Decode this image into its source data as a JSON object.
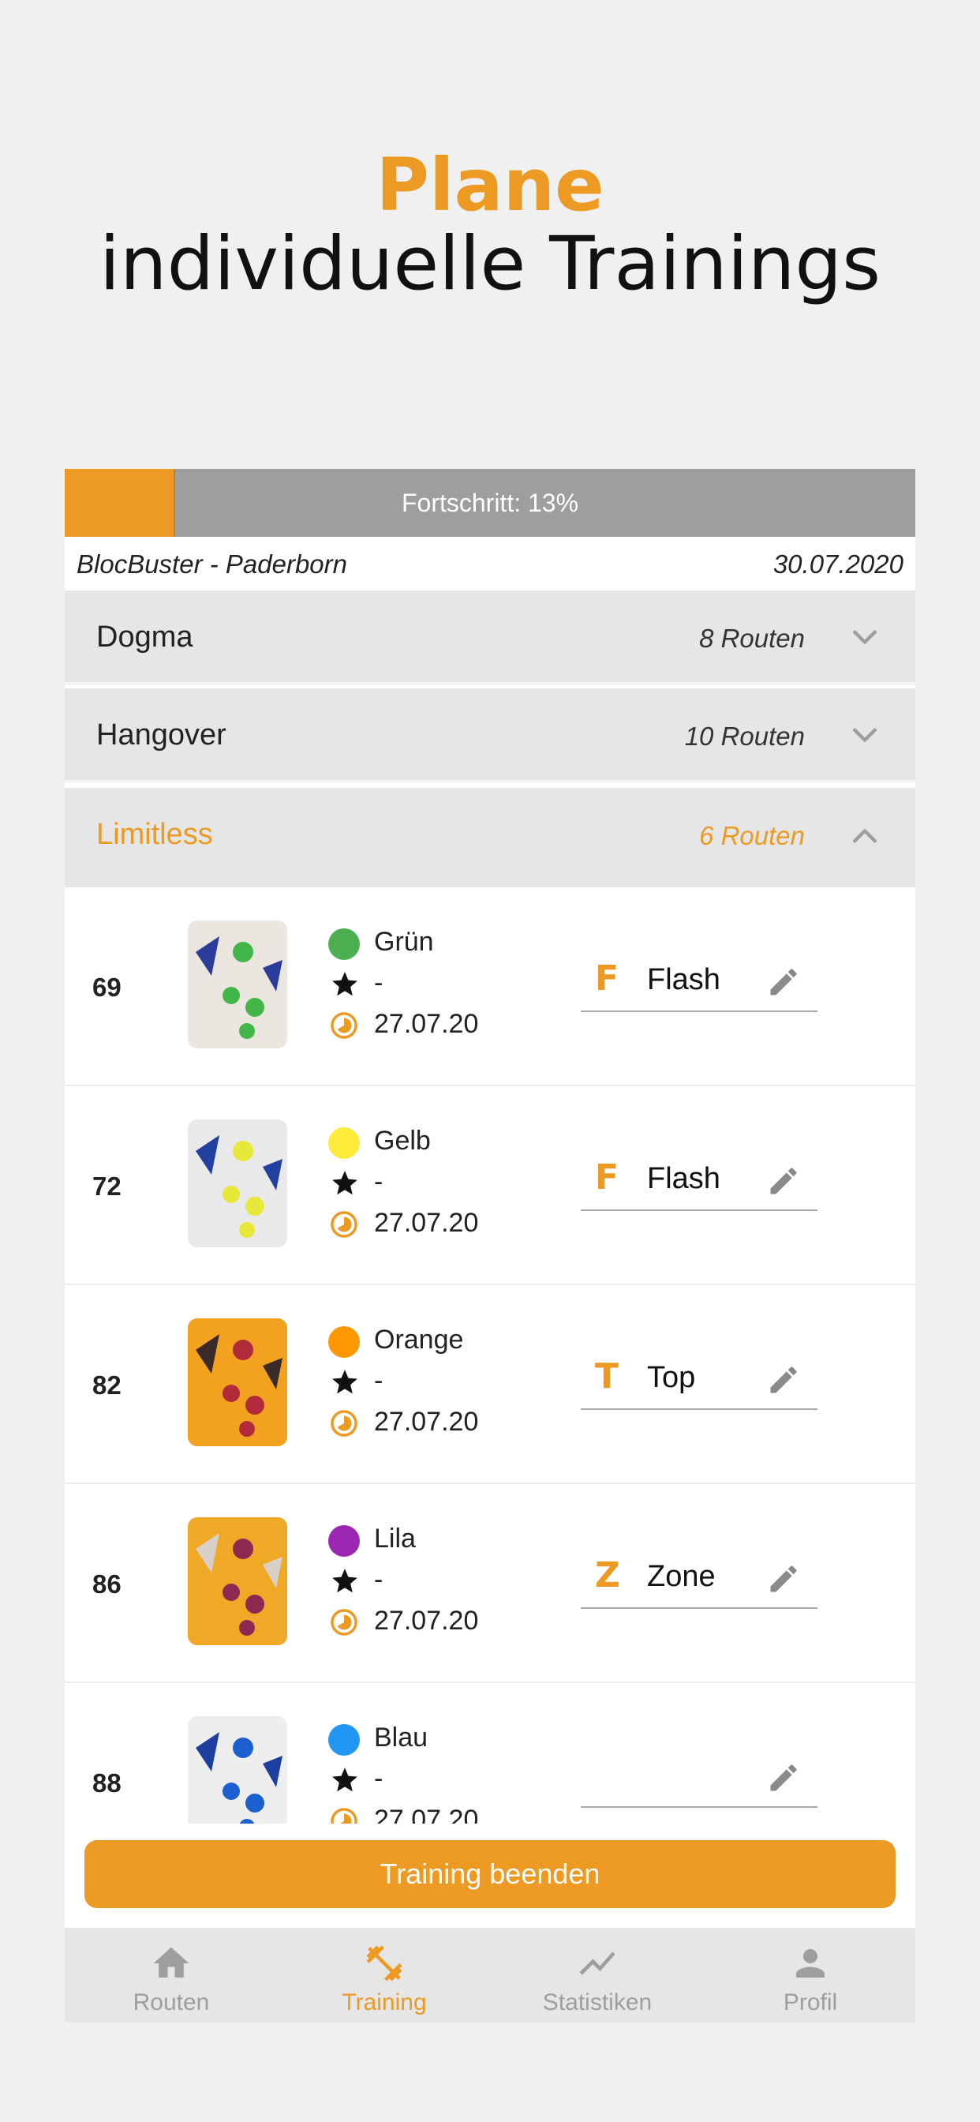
{
  "headline": {
    "line1": "Plane",
    "line2": "individuelle Trainings"
  },
  "progress": {
    "label": "Fortschritt: 13%",
    "value": 0.13
  },
  "session": {
    "location": "BlocBuster - Paderborn",
    "date": "30.07.2020"
  },
  "groups": [
    {
      "name": "Dogma",
      "count": "8 Routen",
      "expanded": false
    },
    {
      "name": "Hangover",
      "count": "10 Routen",
      "expanded": false
    },
    {
      "name": "Limitless",
      "count": "6 Routen",
      "expanded": true
    }
  ],
  "routes": [
    {
      "number": "69",
      "color_name": "Grün",
      "color": "#4caf50",
      "rating": "-",
      "date": "27.07.20",
      "result_letter": "F",
      "result": "Flash",
      "photo_bg": "#ebe7e0",
      "hold": "#43b649",
      "hold2": "#2b3c9a"
    },
    {
      "number": "72",
      "color_name": "Gelb",
      "color": "#ffeb3b",
      "rating": "-",
      "date": "27.07.20",
      "result_letter": "F",
      "result": "Flash",
      "photo_bg": "#e9e9e9",
      "hold": "#e8e83a",
      "hold2": "#2240a0"
    },
    {
      "number": "82",
      "color_name": "Orange",
      "color": "#ff9800",
      "rating": "-",
      "date": "27.07.20",
      "result_letter": "T",
      "result": "Top",
      "photo_bg": "#f2a21f",
      "hold": "#b22b3a",
      "hold2": "#3a2a2a"
    },
    {
      "number": "86",
      "color_name": "Lila",
      "color": "#9c27b0",
      "rating": "-",
      "date": "27.07.20",
      "result_letter": "Z",
      "result": "Zone",
      "photo_bg": "#f0a827",
      "hold": "#8e2850",
      "hold2": "#d8d0c8"
    },
    {
      "number": "88",
      "color_name": "Blau",
      "color": "#2196f3",
      "rating": "-",
      "date": "27.07.20",
      "result_letter": "",
      "result": "",
      "photo_bg": "#eeeeee",
      "hold": "#1c5fd0",
      "hold2": "#1c3fa0"
    }
  ],
  "finish_button": "Training beenden",
  "nav": [
    {
      "label": "Routen",
      "icon": "home-icon",
      "active": false
    },
    {
      "label": "Training",
      "icon": "dumbbell-icon",
      "active": true
    },
    {
      "label": "Statistiken",
      "icon": "chart-line-icon",
      "active": false
    },
    {
      "label": "Profil",
      "icon": "person-icon",
      "active": false
    }
  ],
  "colors": {
    "accent": "#ec9a23",
    "progress_track": "#9e9e9e",
    "group_bg": "#e6e6e6",
    "nav_inactive": "#9e9e9e"
  }
}
